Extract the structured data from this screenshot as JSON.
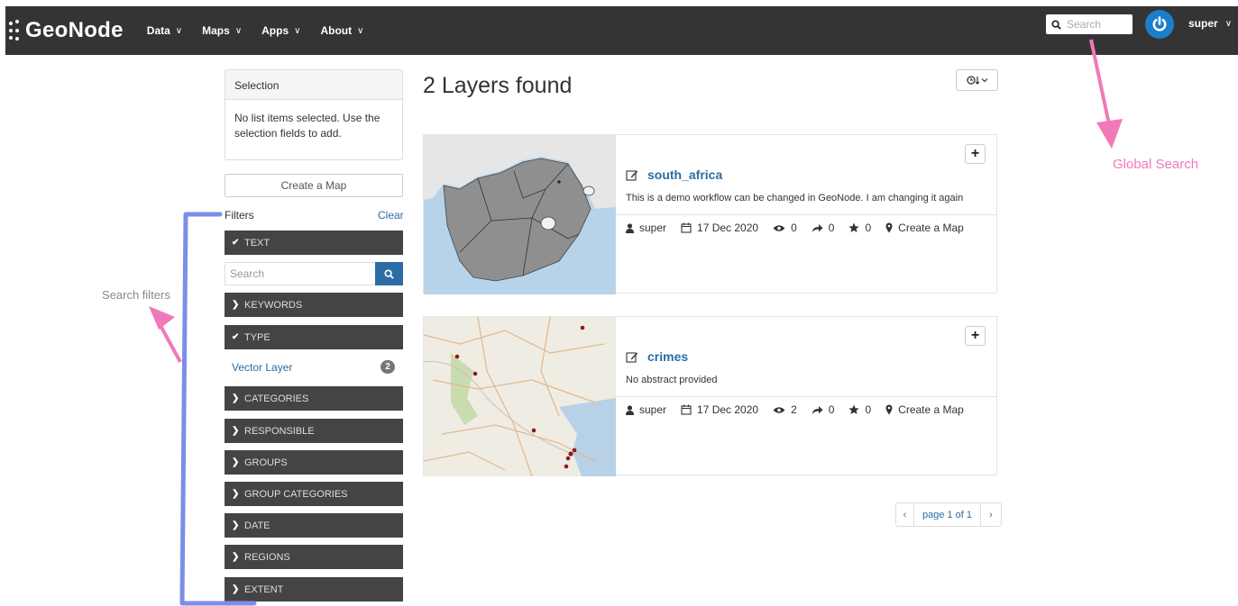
{
  "navbar": {
    "brand": "GeoNode",
    "menu": [
      {
        "label": "Data",
        "name": "nav-data"
      },
      {
        "label": "Maps",
        "name": "nav-maps"
      },
      {
        "label": "Apps",
        "name": "nav-apps"
      },
      {
        "label": "About",
        "name": "nav-about"
      }
    ],
    "search_placeholder": "Search",
    "user": "super"
  },
  "sidebar": {
    "selection": {
      "title": "Selection",
      "message": "No list items selected. Use the selection fields to add."
    },
    "create_map": "Create a Map",
    "filters_title": "Filters",
    "clear_label": "Clear",
    "text_search_placeholder": "Search",
    "facets": {
      "text": "TEXT",
      "keywords": "KEYWORDS",
      "type": "TYPE",
      "categories": "CATEGORIES",
      "responsible": "RESPONSIBLE",
      "groups": "GROUPS",
      "group_categories": "GROUP CATEGORIES",
      "date": "DATE",
      "regions": "REGIONS",
      "extent": "EXTENT"
    },
    "type_option": {
      "label": "Vector Layer",
      "count": "2"
    }
  },
  "results": {
    "title": "2 Layers found",
    "items": [
      {
        "name": "south_africa",
        "abstract": "This is a demo workflow can be changed in GeoNode. I am changing it again",
        "owner": "super",
        "date": "17 Dec 2020",
        "views": "0",
        "shares": "0",
        "rating": "0",
        "action": "Create a Map"
      },
      {
        "name": "crimes",
        "abstract": "No abstract provided",
        "owner": "super",
        "date": "17 Dec 2020",
        "views": "2",
        "shares": "0",
        "rating": "0",
        "action": "Create a Map"
      }
    ]
  },
  "pagination": {
    "prev": "‹",
    "label": "page 1 of 1",
    "next": "›"
  },
  "annotations": {
    "global_search": "Global Search",
    "search_filters": "Search filters"
  },
  "colors": {
    "navbar": "#343434",
    "link": "#2c6da4",
    "facet": "#444444",
    "annotation_pink": "#f07ab8",
    "annotation_blue": "#7b8ee8"
  }
}
